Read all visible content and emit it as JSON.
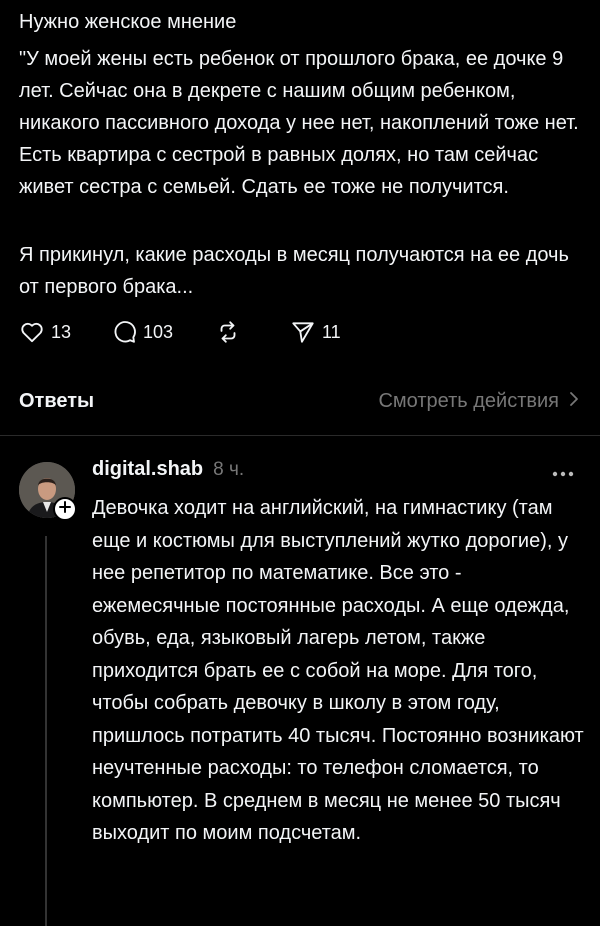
{
  "post": {
    "title": "Нужно женское мнение",
    "paragraph1": "\"У моей жены есть ребенок от прошлого брака, ее дочке 9 лет. Сейчас она в декрете с нашим общим ребенком, никакого пассивного дохода у нее нет, накоплений тоже нет. Есть квартира с сестрой в равных долях, но там сейчас живет сестра с семьей. Сдать ее тоже не получится.",
    "paragraph2": "Я прикинул, какие расходы в месяц получаются на ее дочь от первого брака...",
    "likes": "13",
    "comments": "103",
    "shares": "11"
  },
  "replies_bar": {
    "title": "Ответы",
    "view_actions": "Смотреть действия"
  },
  "reply": {
    "username": "digital.shab",
    "time": "8 ч.",
    "text": "Девочка ходит на английский, на гимнастику (там еще и костюмы для выступлений жутко дорогие), у нее репетитор по математике. Все это - ежемесячные постоянные расходы. А еще одежда, обувь, еда, языковый лагерь летом, также приходится брать ее с собой на море. Для того, чтобы собрать девочку в школу в этом году, пришлось потратить 40 тысяч. Постоянно возникают неучтенные расходы: то телефон сломается, то компьютер. В среднем в месяц не менее 50 тысяч выходит по моим подсчетам."
  },
  "icons": {
    "like": "heart-icon",
    "comment": "comment-bubble-icon",
    "repost": "repost-icon",
    "share": "paper-plane-icon",
    "more": "more-horizontal-icon",
    "follow": "plus-icon",
    "chevron": "chevron-right-icon"
  },
  "colors": {
    "background": "#000000",
    "text": "#f3f5f7",
    "secondary": "#777777",
    "divider": "#2a2a2a"
  }
}
